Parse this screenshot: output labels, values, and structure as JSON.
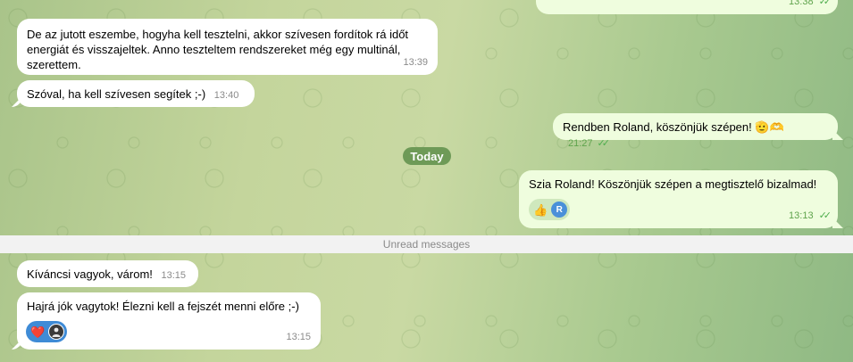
{
  "colors": {
    "incoming_bubble": "#ffffff",
    "outgoing_bubble": "#effdde",
    "date_pill": "#6e9a57",
    "check_green": "#4fae4e",
    "reaction_blue": "#3f8bd6"
  },
  "messages": {
    "top_out_time": "13:38",
    "m1_text": "De az jutott eszembe, hogyha kell tesztelni, akkor szívesen fordítok rá időt energiát és visszajeltek. Anno teszteltem rendszereket még egy multinál, szerettem.",
    "m1_time": "13:39",
    "m2_text": "Szóval, ha kell szívesen segítek ;-)",
    "m2_time": "13:40",
    "m3_text": "Rendben Roland, köszönjük szépen! 🫡🫶",
    "m3_time": "21:27",
    "date_label": "Today",
    "m4_text": "Szia Roland! Köszönjük szépen a megtisztelő bizalmad!",
    "m4_time": "13:13",
    "m4_reaction_emoji": "👍",
    "m4_reaction_avatar": "R",
    "unread_label": "Unread messages",
    "m5_text": "Kíváncsi vagyok, várom!",
    "m5_time": "13:15",
    "m6_text": "Hajrá jók vagytok! Élezni kell a fejszét menni előre ;-)",
    "m6_time": "13:15",
    "m6_reaction_emoji": "❤️"
  },
  "icons": {
    "double_check": "✓✓"
  }
}
